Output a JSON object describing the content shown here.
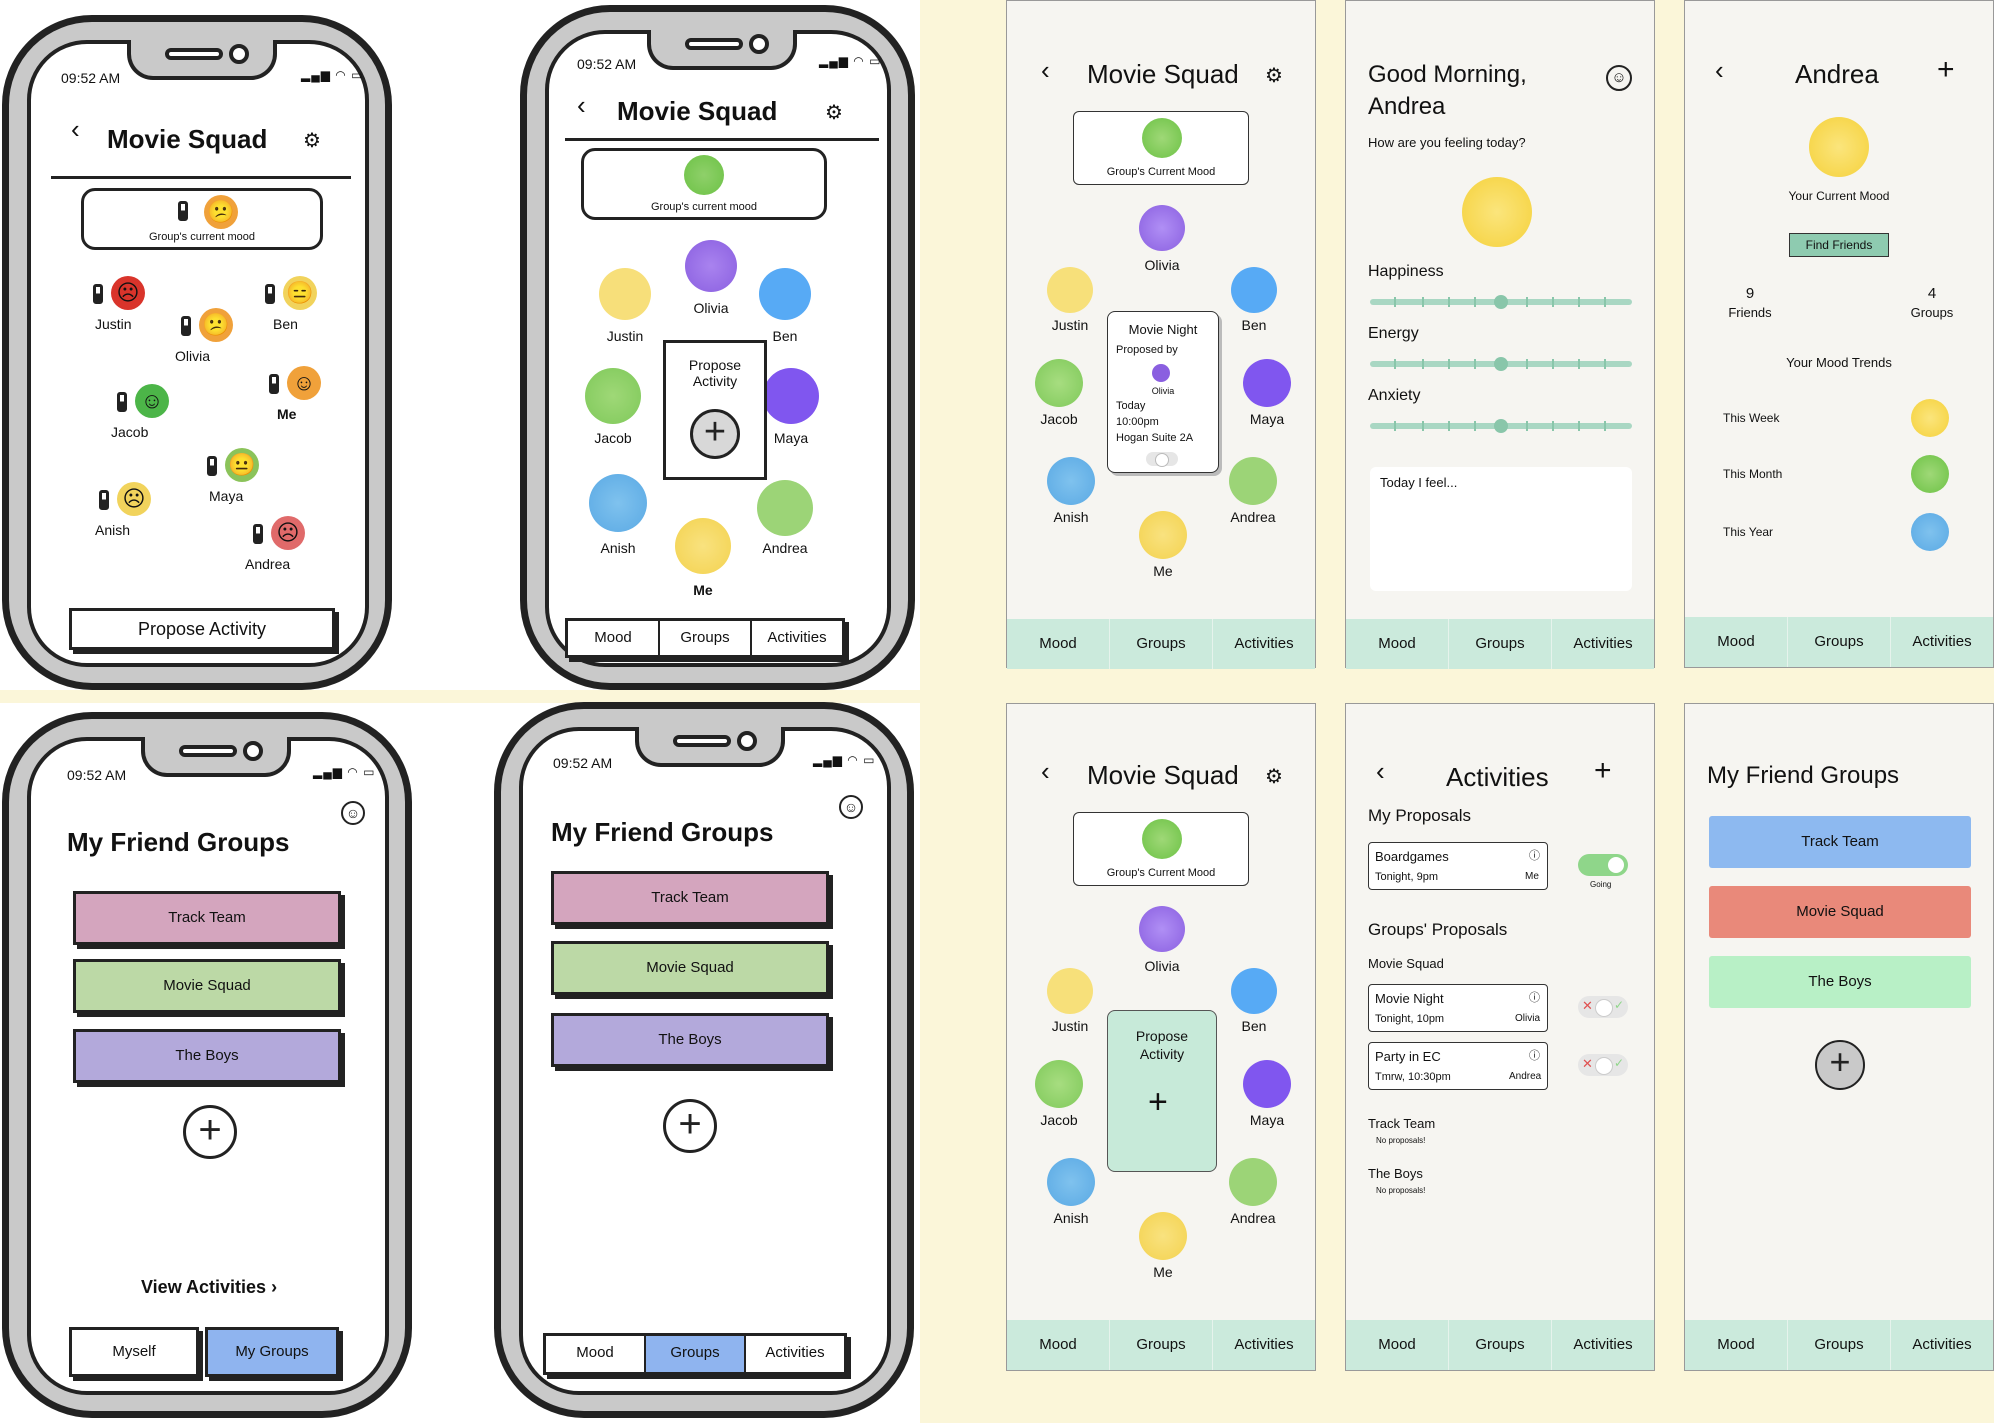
{
  "status": {
    "time": "09:52 AM"
  },
  "sk1": {
    "title": "Movie Squad",
    "mood_label": "Group's current mood",
    "members": [
      {
        "name": "Justin",
        "face": "☹",
        "color": "#d9342b"
      },
      {
        "name": "Ben",
        "face": "😑",
        "color": "#f1d35c"
      },
      {
        "name": "Olivia",
        "face": "😕",
        "color": "#f0a13a"
      },
      {
        "name": "Me",
        "face": "☺",
        "color": "#f0a13a"
      },
      {
        "name": "Jacob",
        "face": "☺",
        "color": "#4cb548"
      },
      {
        "name": "Maya",
        "face": "😐",
        "color": "#8bc35a"
      },
      {
        "name": "Anish",
        "face": "☹",
        "color": "#f1d35c"
      },
      {
        "name": "Andrea",
        "face": "☹",
        "color": "#e06a6a"
      }
    ],
    "propose": "Propose Activity"
  },
  "sk2": {
    "title": "Movie Squad",
    "mood_label": "Group's current mood",
    "members": [
      "Olivia",
      "Justin",
      "Ben",
      "Jacob",
      "Maya",
      "Anish",
      "Andrea",
      "Me"
    ],
    "propose": "Propose Activity",
    "tabs": [
      "Mood",
      "Groups",
      "Activities"
    ]
  },
  "sk3": {
    "title": "My Friend Groups",
    "groups": [
      "Track Team",
      "Movie Squad",
      "The Boys"
    ],
    "view_activities": "View Activities",
    "tabs": [
      "Myself",
      "My Groups"
    ]
  },
  "sk4": {
    "title": "My Friend Groups",
    "groups": [
      "Track Team",
      "Movie Squad",
      "The Boys"
    ],
    "tabs": [
      "Mood",
      "Groups",
      "Activities"
    ]
  },
  "hf1": {
    "title": "Movie Squad",
    "mood_label": "Group's Current Mood",
    "members": [
      "Olivia",
      "Justin",
      "Ben",
      "Jacob",
      "Maya",
      "Anish",
      "Andrea",
      "Me"
    ],
    "popup": {
      "title": "Movie Night",
      "proposed_by": "Proposed by",
      "proposer": "Olivia",
      "day": "Today",
      "time": "10:00pm",
      "place": "Hogan Suite 2A"
    },
    "nav": [
      "Mood",
      "Groups",
      "Activities"
    ]
  },
  "hf2": {
    "greeting": "Good Morning,",
    "name": "Andrea",
    "question": "How are you feeling today?",
    "sliders": [
      "Happiness",
      "Energy",
      "Anxiety"
    ],
    "placeholder": "Today I feel...",
    "nav": [
      "Mood",
      "Groups",
      "Activities"
    ]
  },
  "hf3": {
    "title": "Andrea",
    "current_mood": "Your Current Mood",
    "find_friends": "Find Friends",
    "friends_count": "9",
    "friends_label": "Friends",
    "groups_count": "4",
    "groups_label": "Groups",
    "trends_title": "Your Mood Trends",
    "trends": [
      "This Week",
      "This Month",
      "This Year"
    ],
    "nav": [
      "Mood",
      "Groups",
      "Activities"
    ]
  },
  "hf4": {
    "title": "Movie Squad",
    "mood_label": "Group's Current Mood",
    "members": [
      "Olivia",
      "Justin",
      "Ben",
      "Jacob",
      "Maya",
      "Anish",
      "Andrea",
      "Me"
    ],
    "propose": "Propose Activity",
    "nav": [
      "Mood",
      "Groups",
      "Activities"
    ]
  },
  "hf5": {
    "title": "Activities",
    "my_proposals": "My Proposals",
    "mine": {
      "name": "Boardgames",
      "when": "Tonight, 9pm",
      "who": "Me",
      "status": "Going"
    },
    "groups_proposals": "Groups' Proposals",
    "group_name": "Movie Squad",
    "items": [
      {
        "name": "Movie Night",
        "when": "Tonight, 10pm",
        "who": "Olivia"
      },
      {
        "name": "Party in EC",
        "when": "Tmrw, 10:30pm",
        "who": "Andrea"
      }
    ],
    "other_groups": [
      {
        "name": "Track Team",
        "note": "No proposals!"
      },
      {
        "name": "The Boys",
        "note": "No proposals!"
      }
    ],
    "nav": [
      "Mood",
      "Groups",
      "Activities"
    ]
  },
  "hf6": {
    "title": "My Friend Groups",
    "groups": [
      {
        "name": "Track Team",
        "color": "#8db9f0"
      },
      {
        "name": "Movie Squad",
        "color": "#e9897a"
      },
      {
        "name": "The Boys",
        "color": "#b8f0c6"
      }
    ],
    "nav": [
      "Mood",
      "Groups",
      "Activities"
    ]
  }
}
